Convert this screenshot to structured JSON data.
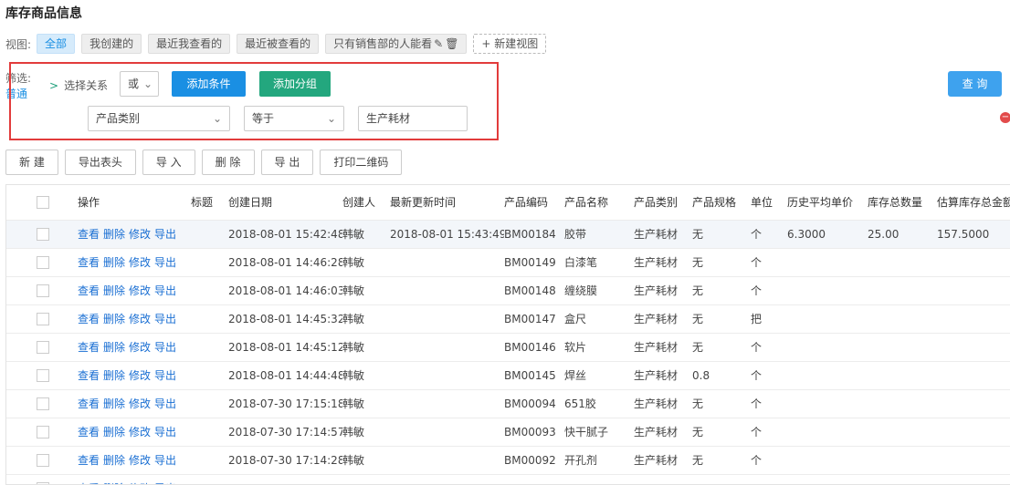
{
  "page": {
    "title": "库存商品信息"
  },
  "views": {
    "label": "视图:",
    "tabs": [
      "全部",
      "我创建的",
      "最近我查看的",
      "最近被查看的",
      "只有销售部的人能看"
    ],
    "new_view": "+ 新建视图"
  },
  "filter": {
    "label": "筛选:",
    "link": "普通",
    "relation_label": "选择关系",
    "relation_value": "或",
    "add_condition": "添加条件",
    "add_group": "添加分组",
    "field": "产品类别",
    "operator": "等于",
    "value": "生产耗材",
    "query": "查 询"
  },
  "actions": [
    "新 建",
    "导出表头",
    "导 入",
    "删 除",
    "导 出",
    "打印二维码"
  ],
  "row_actions": [
    "查看",
    "删除",
    "修改",
    "导出"
  ],
  "table": {
    "headers": [
      "",
      "操作",
      "标题",
      "创建日期",
      "创建人",
      "最新更新时间",
      "产品编码",
      "产品名称",
      "产品类别",
      "产品规格",
      "单位",
      "历史平均单价",
      "库存总数量",
      "估算库存总金额"
    ],
    "rows": [
      {
        "date": "2018-08-01 15:42:48",
        "creator": "韩敏",
        "updated": "2018-08-01 15:43:49",
        "code": "BM00184",
        "name": "胶带",
        "category": "生产耗材",
        "spec": "无",
        "unit": "个",
        "avg_price": "6.3000",
        "qty": "25.00",
        "amount": "157.5000"
      },
      {
        "date": "2018-08-01 14:46:28",
        "creator": "韩敏",
        "updated": "",
        "code": "BM00149",
        "name": "白漆笔",
        "category": "生产耗材",
        "spec": "无",
        "unit": "个",
        "avg_price": "",
        "qty": "",
        "amount": ""
      },
      {
        "date": "2018-08-01 14:46:03",
        "creator": "韩敏",
        "updated": "",
        "code": "BM00148",
        "name": "缠绕膜",
        "category": "生产耗材",
        "spec": "无",
        "unit": "个",
        "avg_price": "",
        "qty": "",
        "amount": ""
      },
      {
        "date": "2018-08-01 14:45:32",
        "creator": "韩敏",
        "updated": "",
        "code": "BM00147",
        "name": "盒尺",
        "category": "生产耗材",
        "spec": "无",
        "unit": "把",
        "avg_price": "",
        "qty": "",
        "amount": ""
      },
      {
        "date": "2018-08-01 14:45:12",
        "creator": "韩敏",
        "updated": "",
        "code": "BM00146",
        "name": "软片",
        "category": "生产耗材",
        "spec": "无",
        "unit": "个",
        "avg_price": "",
        "qty": "",
        "amount": ""
      },
      {
        "date": "2018-08-01 14:44:48",
        "creator": "韩敏",
        "updated": "",
        "code": "BM00145",
        "name": "焊丝",
        "category": "生产耗材",
        "spec": "0.8",
        "unit": "个",
        "avg_price": "",
        "qty": "",
        "amount": ""
      },
      {
        "date": "2018-07-30 17:15:18",
        "creator": "韩敏",
        "updated": "",
        "code": "BM00094",
        "name": "651胶",
        "category": "生产耗材",
        "spec": "无",
        "unit": "个",
        "avg_price": "",
        "qty": "",
        "amount": ""
      },
      {
        "date": "2018-07-30 17:14:57",
        "creator": "韩敏",
        "updated": "",
        "code": "BM00093",
        "name": "快干腻子",
        "category": "生产耗材",
        "spec": "无",
        "unit": "个",
        "avg_price": "",
        "qty": "",
        "amount": ""
      },
      {
        "date": "2018-07-30 17:14:28",
        "creator": "韩敏",
        "updated": "",
        "code": "BM00092",
        "name": "开孔剂",
        "category": "生产耗材",
        "spec": "无",
        "unit": "个",
        "avg_price": "",
        "qty": "",
        "amount": ""
      },
      {
        "date": "",
        "creator": "",
        "updated": "",
        "code": "",
        "name": "",
        "category": "",
        "spec": "",
        "unit": "",
        "avg_price": "",
        "qty": "",
        "amount": ""
      }
    ]
  }
}
